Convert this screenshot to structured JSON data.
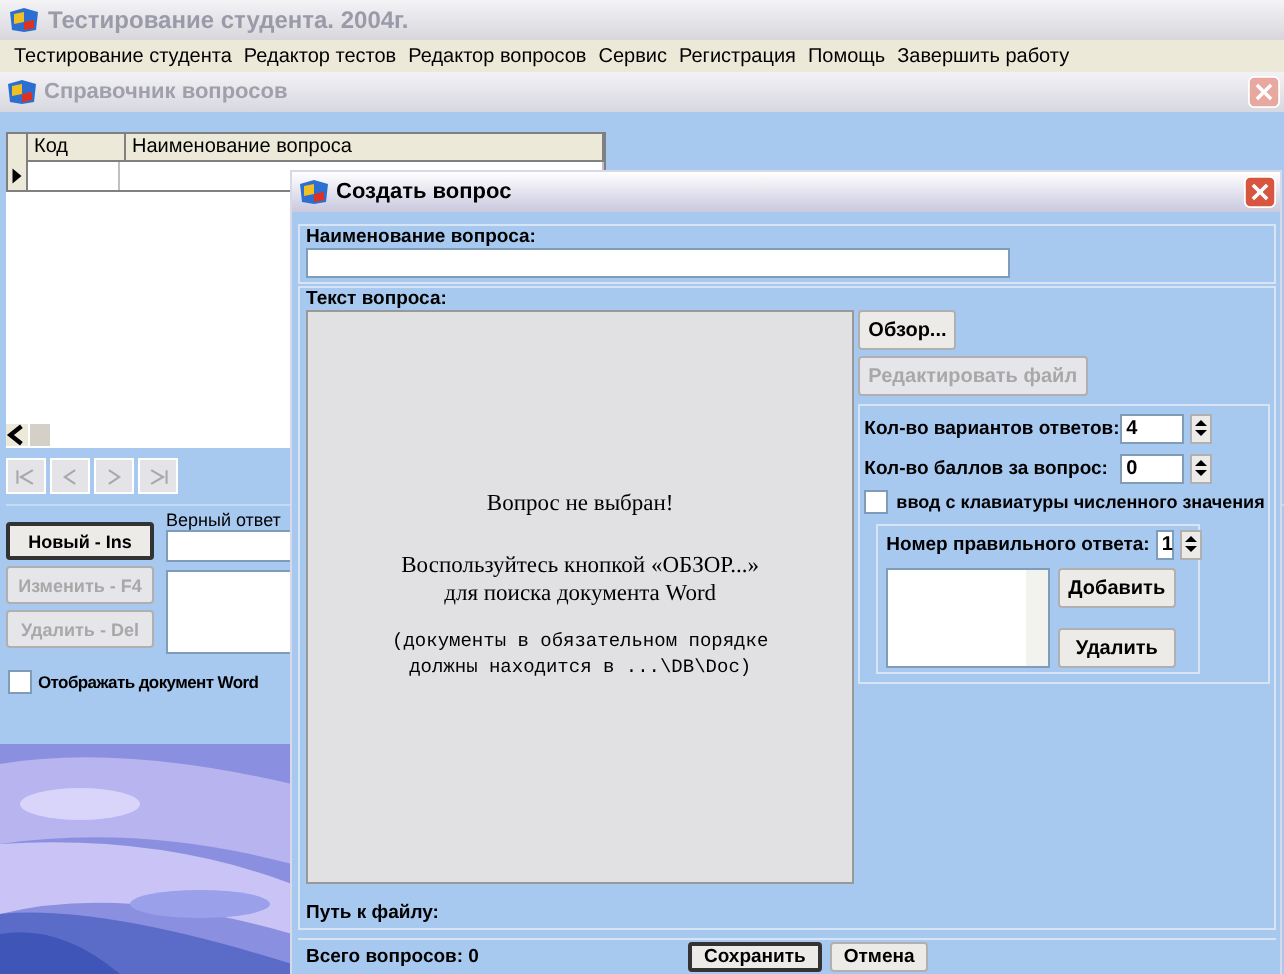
{
  "app": {
    "title": "Тестирование студента. 2004г."
  },
  "menu": [
    "Тестирование студента",
    "Редактор тестов",
    "Редактор вопросов",
    "Сервис",
    "Регистрация",
    "Помощь",
    "Завершить работу"
  ],
  "catalog": {
    "title": "Справочник вопросов",
    "columns": [
      "Код",
      "Наименование вопроса"
    ],
    "nav_buttons": [
      {
        "kind": "first",
        "disabled": true
      },
      {
        "kind": "prev",
        "disabled": true
      },
      {
        "kind": "next",
        "disabled": true
      },
      {
        "kind": "last",
        "disabled": true
      }
    ],
    "buttons": [
      {
        "label": "Новый - Ins",
        "disabled": false
      },
      {
        "label": "Изменить - F4",
        "disabled": true
      },
      {
        "label": "Удалить - Del",
        "disabled": true
      }
    ],
    "answer_label": "Верный ответ",
    "show_word": {
      "label": "Отображать документ Word",
      "checked": false
    }
  },
  "dialog": {
    "title": "Создать вопрос",
    "name_label": "Наименование вопроса:",
    "text_label": "Текст вопроса:",
    "message": [
      "Вопрос не выбран!",
      "Воспользуйтесь кнопкой «ОБЗОР...»\nдля поиска документа Word",
      "(документы в обязательном порядке\nдолжны находится в ...\\DB\\Doc)"
    ],
    "browse_button": {
      "label": "Обзор...",
      "disabled": false
    },
    "edit_button": {
      "label": "Редактировать файл",
      "disabled": true
    },
    "spinners": [
      {
        "label": "Кол-во вариантов ответов:",
        "value": "4"
      },
      {
        "label": "Кол-во баллов за вопрос:",
        "value": "0"
      }
    ],
    "keyboard_input": {
      "label": "ввод с клавиатуры численного значения",
      "checked": false
    },
    "correct_answer": {
      "label": "Номер правильного ответа:",
      "value": "1"
    },
    "add_button": "Добавить",
    "remove_button": "Удалить",
    "path_label": "Путь к файлу:",
    "total": "Всего вопросов: 0",
    "footer_buttons": [
      "Сохранить",
      "Отмена"
    ]
  }
}
